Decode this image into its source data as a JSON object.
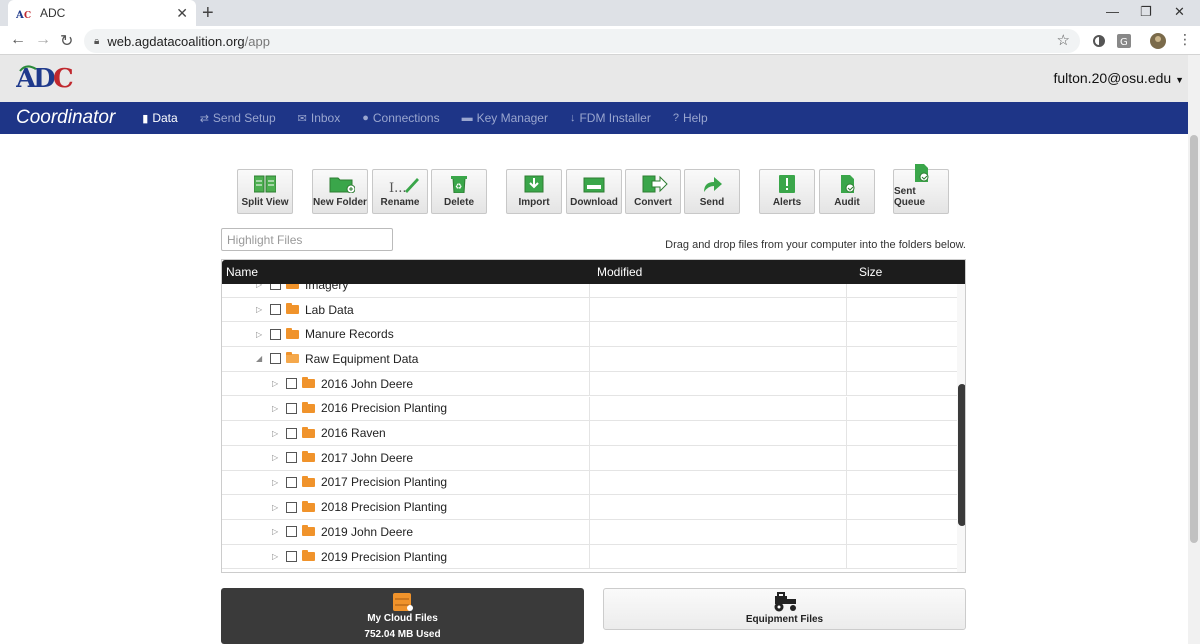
{
  "browser": {
    "tab_title": "ADC",
    "url_host": "web.agdatacoalition.org",
    "url_path": "/app"
  },
  "header": {
    "logo_text": "ADC",
    "user_email": "fulton.20@osu.edu"
  },
  "nav": {
    "brand": "Coordinator",
    "items": [
      {
        "label": "Data",
        "icon": "file-icon",
        "active": true
      },
      {
        "label": "Send Setup",
        "icon": "retweet-icon",
        "active": false
      },
      {
        "label": "Inbox",
        "icon": "envelope-icon",
        "active": false
      },
      {
        "label": "Connections",
        "icon": "user-icon",
        "active": false
      },
      {
        "label": "Key Manager",
        "icon": "briefcase-icon",
        "active": false
      },
      {
        "label": "FDM Installer",
        "icon": "download-icon",
        "active": false
      },
      {
        "label": "Help",
        "icon": "question-icon",
        "active": false
      }
    ]
  },
  "toolbar": {
    "split_view": "Split View",
    "new_folder": "New Folder",
    "rename": "Rename",
    "delete": "Delete",
    "import": "Import",
    "download": "Download",
    "convert": "Convert",
    "send": "Send",
    "alerts": "Alerts",
    "audit": "Audit",
    "sent_queue": "Sent Queue"
  },
  "search": {
    "placeholder": "Highlight Files"
  },
  "hint": "Drag and drop files from your computer into the folders below.",
  "grid": {
    "columns": [
      "Name",
      "Modified",
      "Size"
    ],
    "rows": [
      {
        "name": "Imagery",
        "level": 0,
        "expanded": false
      },
      {
        "name": "Lab Data",
        "level": 0,
        "expanded": false
      },
      {
        "name": "Manure Records",
        "level": 0,
        "expanded": false
      },
      {
        "name": "Raw Equipment Data",
        "level": 0,
        "expanded": true
      },
      {
        "name": "2016 John Deere",
        "level": 1,
        "expanded": false
      },
      {
        "name": "2016 Precision Planting",
        "level": 1,
        "expanded": false
      },
      {
        "name": "2016 Raven",
        "level": 1,
        "expanded": false
      },
      {
        "name": "2017 John Deere",
        "level": 1,
        "expanded": false
      },
      {
        "name": "2017 Precision Planting",
        "level": 1,
        "expanded": false
      },
      {
        "name": "2018 Precision Planting",
        "level": 1,
        "expanded": false
      },
      {
        "name": "2019 John Deere",
        "level": 1,
        "expanded": false
      },
      {
        "name": "2019 Precision Planting",
        "level": 1,
        "expanded": false
      }
    ]
  },
  "bottom": {
    "cloud_label": "My Cloud Files",
    "cloud_usage": "752.04 MB Used",
    "equipment_label": "Equipment Files"
  },
  "colors": {
    "navbar": "#1e3587",
    "folder": "#f0932b",
    "toolbar_icon": "#3aa64a"
  }
}
